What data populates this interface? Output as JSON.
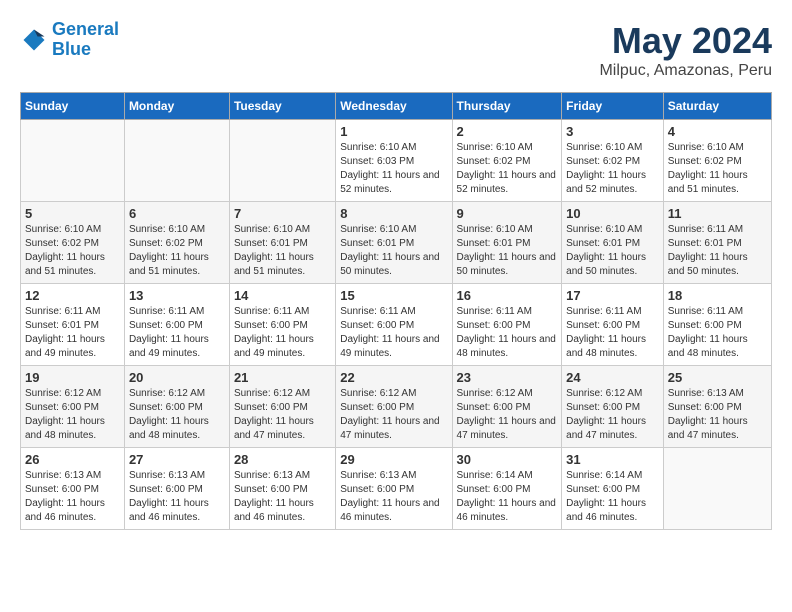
{
  "header": {
    "logo_line1": "General",
    "logo_line2": "Blue",
    "title": "May 2024",
    "subtitle": "Milpuc, Amazonas, Peru"
  },
  "columns": [
    "Sunday",
    "Monday",
    "Tuesday",
    "Wednesday",
    "Thursday",
    "Friday",
    "Saturday"
  ],
  "weeks": [
    {
      "cells": [
        {
          "empty": true
        },
        {
          "empty": true
        },
        {
          "empty": true
        },
        {
          "day": 1,
          "sunrise": "6:10 AM",
          "sunset": "6:03 PM",
          "daylight": "11 hours and 52 minutes."
        },
        {
          "day": 2,
          "sunrise": "6:10 AM",
          "sunset": "6:02 PM",
          "daylight": "11 hours and 52 minutes."
        },
        {
          "day": 3,
          "sunrise": "6:10 AM",
          "sunset": "6:02 PM",
          "daylight": "11 hours and 52 minutes."
        },
        {
          "day": 4,
          "sunrise": "6:10 AM",
          "sunset": "6:02 PM",
          "daylight": "11 hours and 51 minutes."
        }
      ]
    },
    {
      "cells": [
        {
          "day": 5,
          "sunrise": "6:10 AM",
          "sunset": "6:02 PM",
          "daylight": "11 hours and 51 minutes."
        },
        {
          "day": 6,
          "sunrise": "6:10 AM",
          "sunset": "6:02 PM",
          "daylight": "11 hours and 51 minutes."
        },
        {
          "day": 7,
          "sunrise": "6:10 AM",
          "sunset": "6:01 PM",
          "daylight": "11 hours and 51 minutes."
        },
        {
          "day": 8,
          "sunrise": "6:10 AM",
          "sunset": "6:01 PM",
          "daylight": "11 hours and 50 minutes."
        },
        {
          "day": 9,
          "sunrise": "6:10 AM",
          "sunset": "6:01 PM",
          "daylight": "11 hours and 50 minutes."
        },
        {
          "day": 10,
          "sunrise": "6:10 AM",
          "sunset": "6:01 PM",
          "daylight": "11 hours and 50 minutes."
        },
        {
          "day": 11,
          "sunrise": "6:11 AM",
          "sunset": "6:01 PM",
          "daylight": "11 hours and 50 minutes."
        }
      ]
    },
    {
      "cells": [
        {
          "day": 12,
          "sunrise": "6:11 AM",
          "sunset": "6:01 PM",
          "daylight": "11 hours and 49 minutes."
        },
        {
          "day": 13,
          "sunrise": "6:11 AM",
          "sunset": "6:00 PM",
          "daylight": "11 hours and 49 minutes."
        },
        {
          "day": 14,
          "sunrise": "6:11 AM",
          "sunset": "6:00 PM",
          "daylight": "11 hours and 49 minutes."
        },
        {
          "day": 15,
          "sunrise": "6:11 AM",
          "sunset": "6:00 PM",
          "daylight": "11 hours and 49 minutes."
        },
        {
          "day": 16,
          "sunrise": "6:11 AM",
          "sunset": "6:00 PM",
          "daylight": "11 hours and 48 minutes."
        },
        {
          "day": 17,
          "sunrise": "6:11 AM",
          "sunset": "6:00 PM",
          "daylight": "11 hours and 48 minutes."
        },
        {
          "day": 18,
          "sunrise": "6:11 AM",
          "sunset": "6:00 PM",
          "daylight": "11 hours and 48 minutes."
        }
      ]
    },
    {
      "cells": [
        {
          "day": 19,
          "sunrise": "6:12 AM",
          "sunset": "6:00 PM",
          "daylight": "11 hours and 48 minutes."
        },
        {
          "day": 20,
          "sunrise": "6:12 AM",
          "sunset": "6:00 PM",
          "daylight": "11 hours and 48 minutes."
        },
        {
          "day": 21,
          "sunrise": "6:12 AM",
          "sunset": "6:00 PM",
          "daylight": "11 hours and 47 minutes."
        },
        {
          "day": 22,
          "sunrise": "6:12 AM",
          "sunset": "6:00 PM",
          "daylight": "11 hours and 47 minutes."
        },
        {
          "day": 23,
          "sunrise": "6:12 AM",
          "sunset": "6:00 PM",
          "daylight": "11 hours and 47 minutes."
        },
        {
          "day": 24,
          "sunrise": "6:12 AM",
          "sunset": "6:00 PM",
          "daylight": "11 hours and 47 minutes."
        },
        {
          "day": 25,
          "sunrise": "6:13 AM",
          "sunset": "6:00 PM",
          "daylight": "11 hours and 47 minutes."
        }
      ]
    },
    {
      "cells": [
        {
          "day": 26,
          "sunrise": "6:13 AM",
          "sunset": "6:00 PM",
          "daylight": "11 hours and 46 minutes."
        },
        {
          "day": 27,
          "sunrise": "6:13 AM",
          "sunset": "6:00 PM",
          "daylight": "11 hours and 46 minutes."
        },
        {
          "day": 28,
          "sunrise": "6:13 AM",
          "sunset": "6:00 PM",
          "daylight": "11 hours and 46 minutes."
        },
        {
          "day": 29,
          "sunrise": "6:13 AM",
          "sunset": "6:00 PM",
          "daylight": "11 hours and 46 minutes."
        },
        {
          "day": 30,
          "sunrise": "6:14 AM",
          "sunset": "6:00 PM",
          "daylight": "11 hours and 46 minutes."
        },
        {
          "day": 31,
          "sunrise": "6:14 AM",
          "sunset": "6:00 PM",
          "daylight": "11 hours and 46 minutes."
        },
        {
          "empty": true
        }
      ]
    }
  ]
}
